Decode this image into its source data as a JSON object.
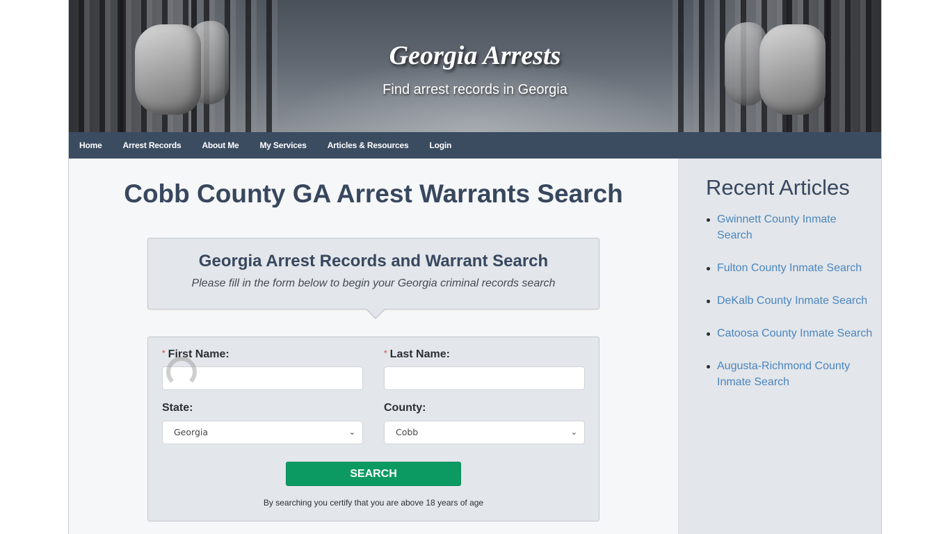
{
  "header": {
    "site_title": "Georgia Arrests",
    "tagline": "Find arrest records in Georgia"
  },
  "nav": {
    "items": [
      {
        "label": "Home"
      },
      {
        "label": "Arrest Records"
      },
      {
        "label": "About Me"
      },
      {
        "label": "My Services"
      },
      {
        "label": "Articles & Resources"
      },
      {
        "label": "Login"
      }
    ]
  },
  "main": {
    "page_title": "Cobb County GA Arrest Warrants Search",
    "intro": {
      "heading": "Georgia Arrest Records and Warrant Search",
      "subheading": "Please fill in the form below to begin your Georgia criminal records search"
    },
    "form": {
      "required_marker": "*",
      "first_name": {
        "label": "First Name:",
        "value": "",
        "placeholder": ""
      },
      "last_name": {
        "label": "Last Name:",
        "value": "",
        "placeholder": ""
      },
      "state": {
        "label": "State:",
        "selected": "Georgia"
      },
      "county": {
        "label": "County:",
        "selected": "Cobb"
      },
      "search_button": "SEARCH",
      "disclaimer": "By searching you certify that you are above 18 years of age"
    }
  },
  "sidebar": {
    "heading": "Recent Articles",
    "articles": [
      {
        "label": "Gwinnett County Inmate Search"
      },
      {
        "label": "Fulton County Inmate Search"
      },
      {
        "label": "DeKalb County Inmate Search"
      },
      {
        "label": "Catoosa County Inmate Search"
      },
      {
        "label": "Augusta-Richmond County Inmate Search"
      }
    ]
  },
  "colors": {
    "nav_bg": "#2c3e55",
    "heading": "#37475e",
    "link": "#4a86bf",
    "search_button": "#0c9a62",
    "required": "#e0393e"
  }
}
